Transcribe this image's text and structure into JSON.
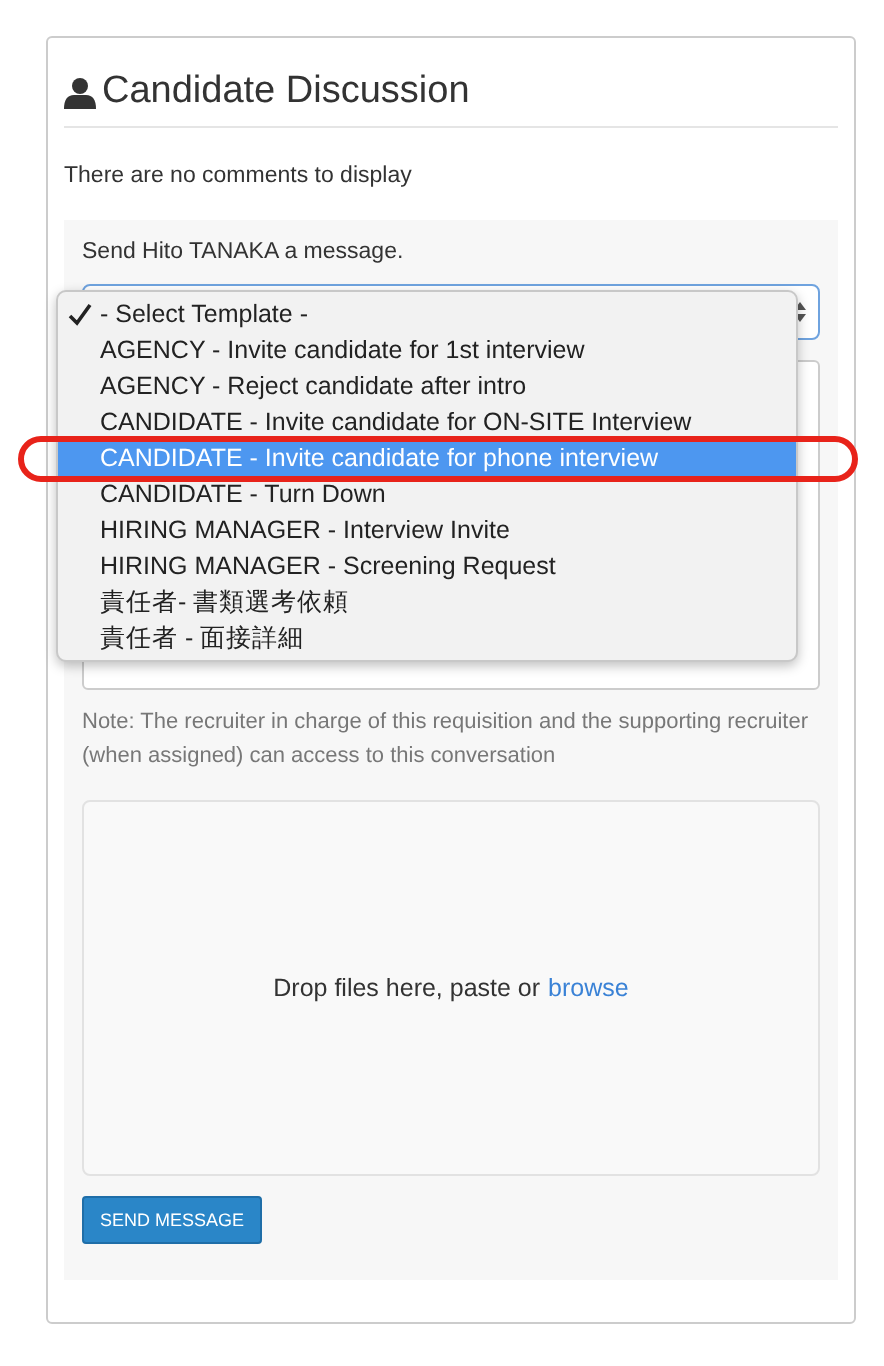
{
  "panel": {
    "title": "Candidate Discussion",
    "empty_text": "There are no comments to display"
  },
  "composer": {
    "prompt": "Send Hito TANAKA a message.",
    "template_menu": [
      {
        "label": "- Select Template -",
        "checked": true,
        "highlighted": false
      },
      {
        "label": "AGENCY - Invite candidate for 1st interview",
        "checked": false,
        "highlighted": false
      },
      {
        "label": "AGENCY - Reject candidate after intro",
        "checked": false,
        "highlighted": false
      },
      {
        "label": "CANDIDATE - Invite candidate for ON-SITE Interview",
        "checked": false,
        "highlighted": false
      },
      {
        "label": "CANDIDATE - Invite candidate for phone interview",
        "checked": false,
        "highlighted": true
      },
      {
        "label": "CANDIDATE - Turn Down",
        "checked": false,
        "highlighted": false
      },
      {
        "label": "HIRING MANAGER - Interview Invite",
        "checked": false,
        "highlighted": false
      },
      {
        "label": "HIRING MANAGER - Screening Request",
        "checked": false,
        "highlighted": false
      },
      {
        "label": "責任者- 書類選考依頼",
        "checked": false,
        "highlighted": false
      },
      {
        "label": "責任者 - 面接詳細",
        "checked": false,
        "highlighted": false
      }
    ],
    "note": "Note: The recruiter in charge of this requisition and the supporting recruiter (when assigned) can access to this conversation",
    "dropzone": {
      "text": "Drop files here, paste or",
      "link": "browse"
    },
    "send_button": "SEND MESSAGE"
  }
}
